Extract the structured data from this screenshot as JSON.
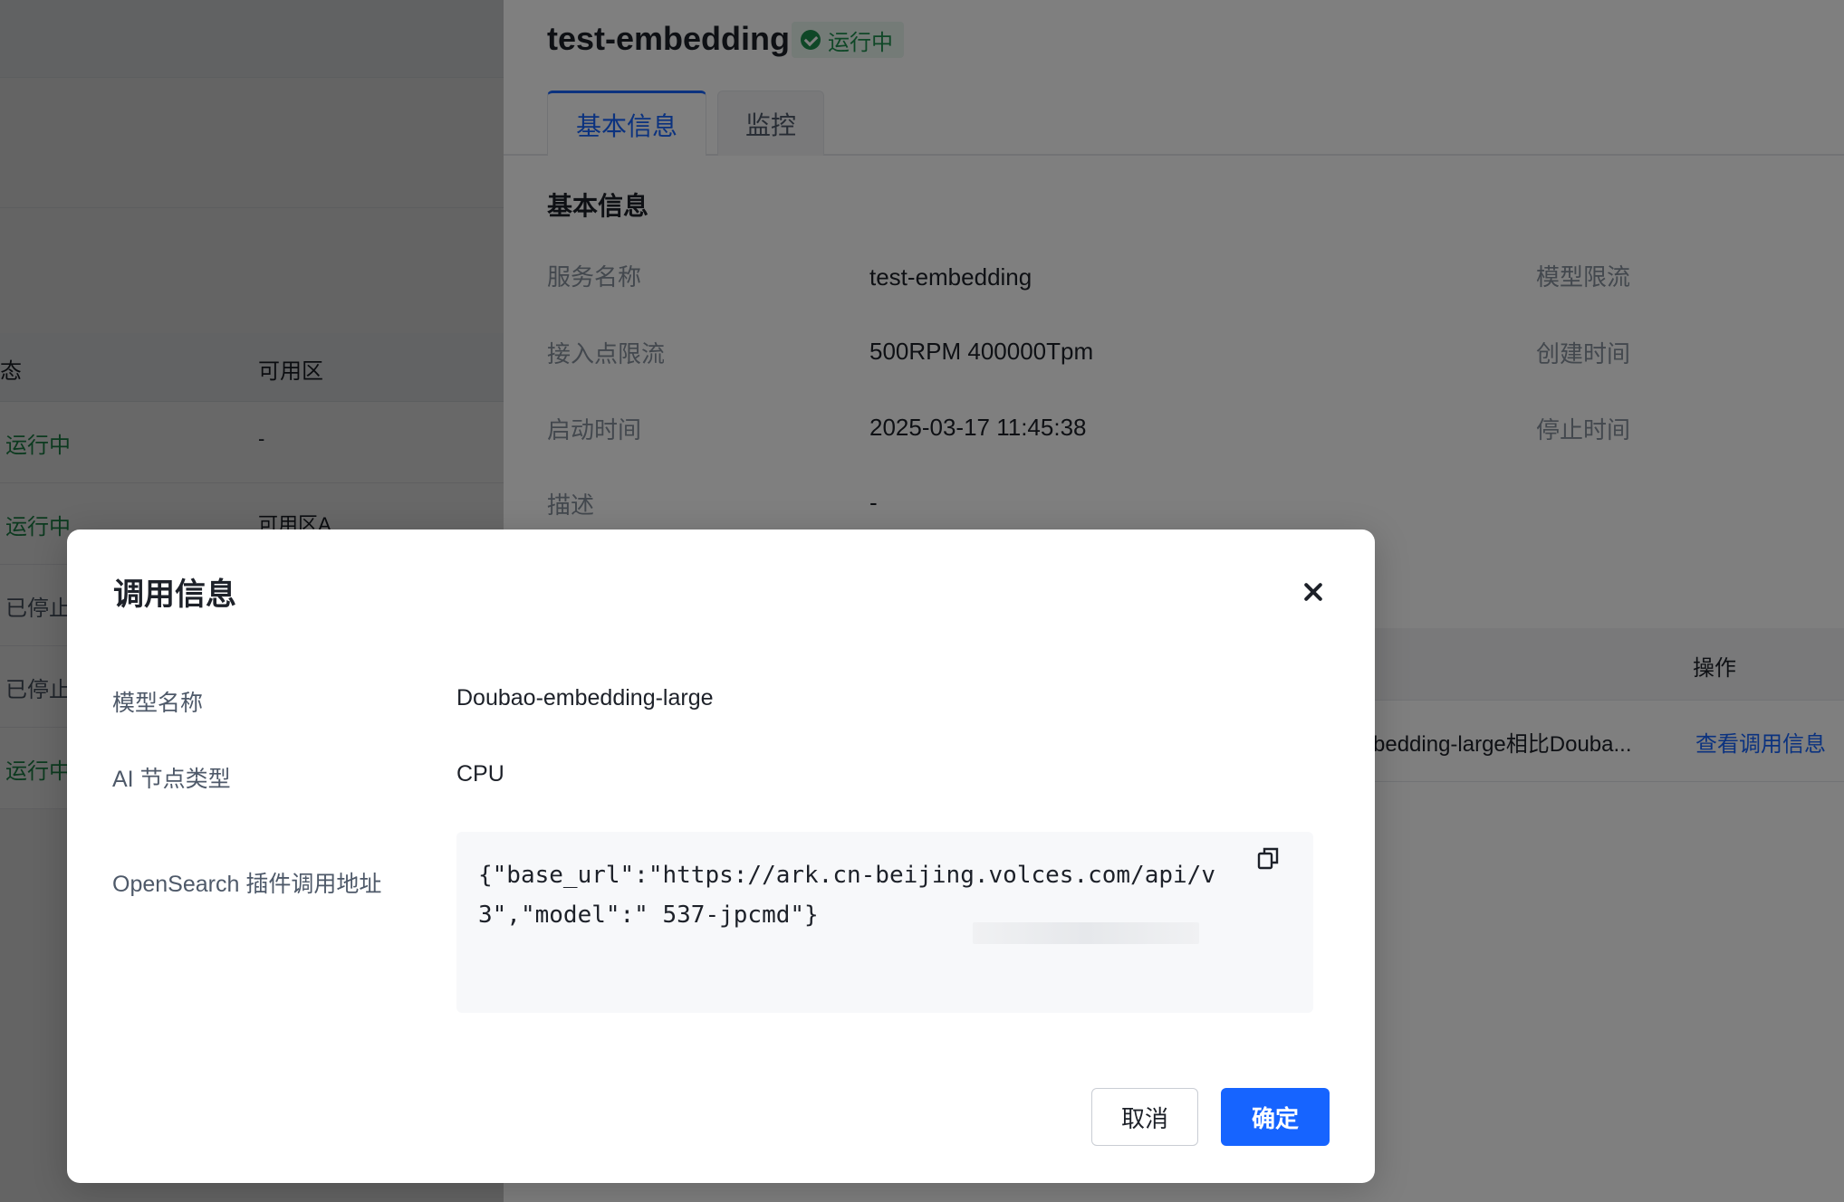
{
  "list": {
    "headers": {
      "status": "态",
      "zone": "可用区"
    },
    "rows": [
      {
        "status": "运行中",
        "zone": "-",
        "state": "run"
      },
      {
        "status": "运行中",
        "zone": "可用区A",
        "state": "run"
      },
      {
        "status": "已停止",
        "zone": "",
        "state": "stop"
      },
      {
        "status": "已停止",
        "zone": "",
        "state": "stop"
      },
      {
        "status": "运行中",
        "zone": "",
        "state": "run"
      }
    ]
  },
  "detail": {
    "title": "test-embedding",
    "status_badge": "运行中",
    "tabs": [
      {
        "label": "基本信息",
        "active": true
      },
      {
        "label": "监控",
        "active": false
      }
    ],
    "section_title": "基本信息",
    "fields": {
      "service_name": {
        "label": "服务名称",
        "value": "test-embedding"
      },
      "endpoint_limit": {
        "label": "接入点限流",
        "value": "500RPM 400000Tpm"
      },
      "start_time": {
        "label": "启动时间",
        "value": "2025-03-17 11:45:38"
      },
      "description": {
        "label": "描述",
        "value": "-"
      },
      "model_limit": {
        "label": "模型限流"
      },
      "create_time": {
        "label": "创建时间"
      },
      "stop_time": {
        "label": "停止时间"
      }
    },
    "table": {
      "action_header": "操作",
      "row_desc": "bedding-large相比Douba...",
      "row_action": "查看调用信息"
    }
  },
  "modal": {
    "title": "调用信息",
    "model_name_label": "模型名称",
    "model_name_value": "Doubao-embedding-large",
    "node_type_label": "AI 节点类型",
    "node_type_value": "CPU",
    "url_label": "OpenSearch 插件调用地址",
    "code": "{\"base_url\":\"https://ark.cn-beijing.volces.com/api/v3\",\"model\":\"                537-jpcmd\"}",
    "cancel_label": "取消",
    "ok_label": "确定"
  },
  "colors": {
    "accent": "#1664ff",
    "success": "#1f8f4e"
  }
}
